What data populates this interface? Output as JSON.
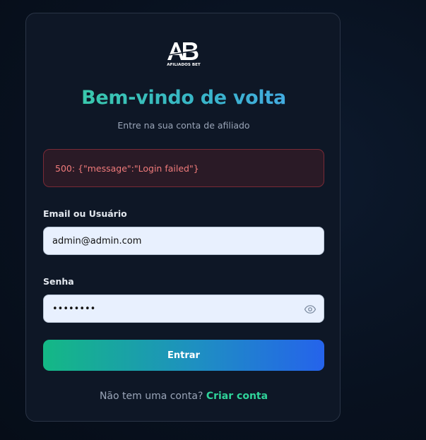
{
  "logo": {
    "brand_text": "AFILIADOS BET"
  },
  "header": {
    "title": "Bem-vindo de volta",
    "subtitle": "Entre na sua conta de afiliado"
  },
  "error": {
    "message": "500: {\"message\":\"Login failed\"}"
  },
  "form": {
    "email_label": "Email ou Usuário",
    "email_value": "admin@admin.com",
    "password_label": "Senha",
    "password_value": "admin123",
    "submit_label": "Entrar"
  },
  "footer": {
    "prompt": "Não tem uma conta?",
    "link": "Criar conta"
  },
  "colors": {
    "accent_green": "#2fd39a",
    "accent_blue": "#2563eb",
    "error": "#f07b7b",
    "card_bg": "#0e1726"
  },
  "icons": {
    "password_toggle": "eye-icon"
  }
}
